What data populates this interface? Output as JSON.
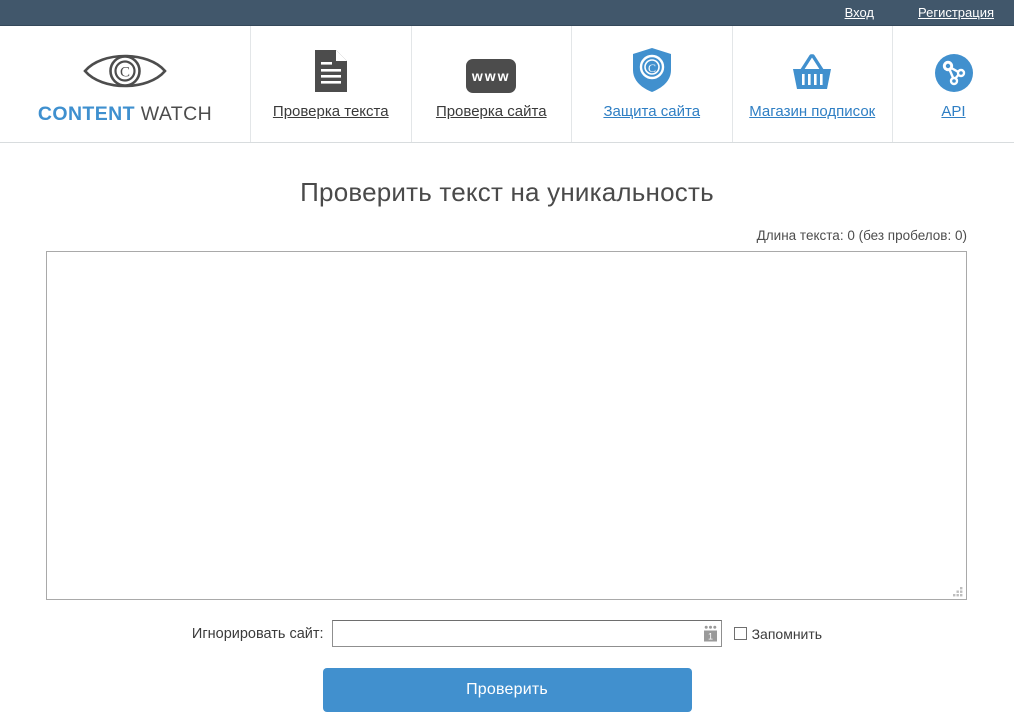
{
  "topbar": {
    "login_label": "Вход",
    "register_label": "Регистрация",
    "background": "#41576b"
  },
  "brand": {
    "name_part1": "CONTENT",
    "name_part2": "WATCH",
    "logo_icon": "eye-copyright-icon",
    "color_primary": "#3f90cf",
    "color_secondary": "#4c4c4c"
  },
  "nav": {
    "items": [
      {
        "label": "Проверка текста",
        "icon": "document-icon",
        "style": "dark",
        "last": false
      },
      {
        "label": "Проверка сайта",
        "icon": "www-icon",
        "style": "dark",
        "last": false
      },
      {
        "label": "Защита сайта",
        "icon": "shield-copyright-icon",
        "style": "blue",
        "last": false
      },
      {
        "label": "Магазин подписок",
        "icon": "shopping-basket-icon",
        "style": "blue",
        "last": false
      },
      {
        "label": "API",
        "icon": "api-network-icon",
        "style": "blue",
        "last": true
      }
    ]
  },
  "main": {
    "title": "Проверить текст на уникальность",
    "text_length_info": "Длина текста: 0 (без пробелов: 0)",
    "textarea_value": "",
    "textarea_placeholder": "",
    "ignore_site_label": "Игнорировать сайт:",
    "ignore_site_value": "",
    "ignore_site_placeholder": "",
    "ignore_site_badge_icon": "autofill-badge-icon",
    "remember_label": "Запомнить",
    "remember_checked": false,
    "submit_label": "Проверить",
    "submit_color": "#4190ce",
    "resize_grip_icon": "resize-grip-icon"
  }
}
